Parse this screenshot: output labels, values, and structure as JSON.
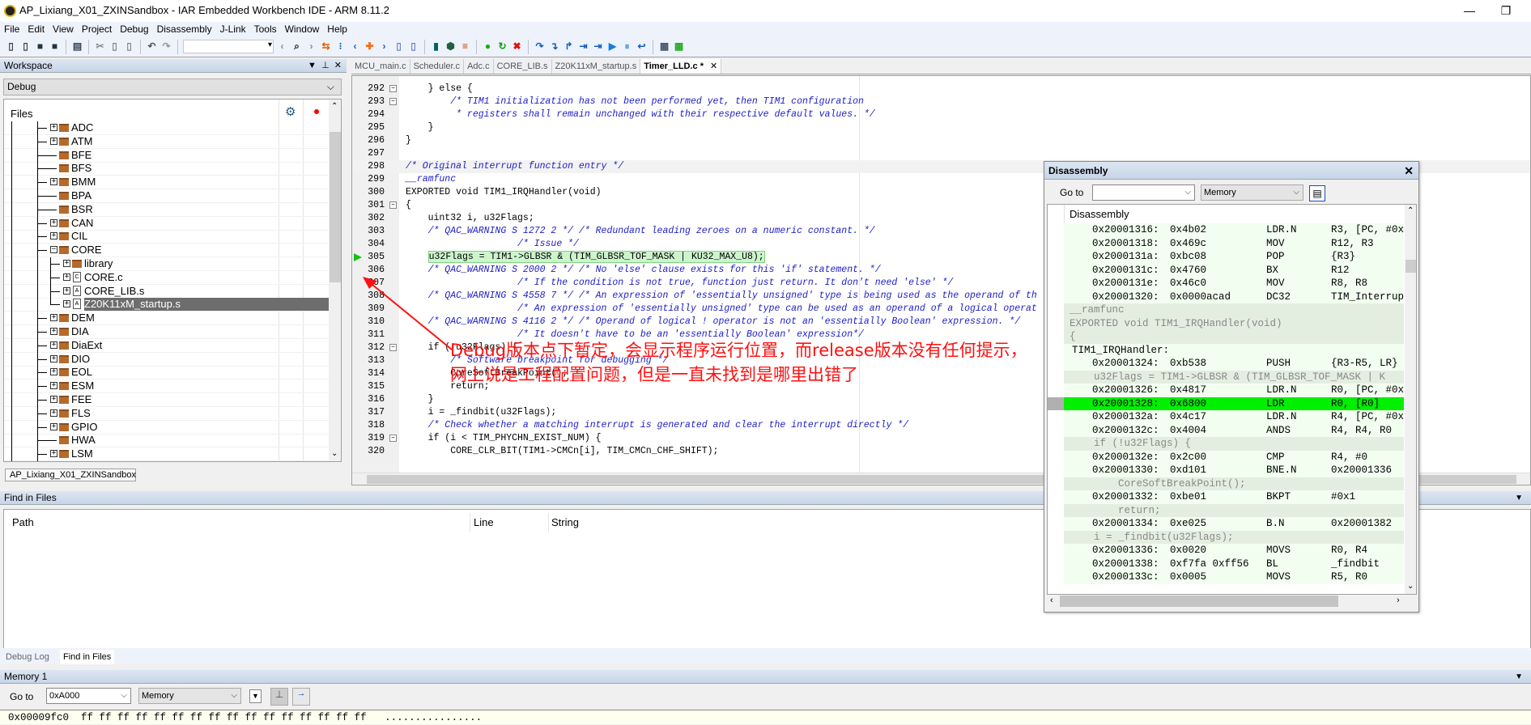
{
  "window": {
    "title": "AP_Lixiang_X01_ZXINSandbox - IAR Embedded Workbench IDE - ARM 8.11.2",
    "minimize": "—",
    "restore": "❐"
  },
  "menu": [
    "File",
    "Edit",
    "View",
    "Project",
    "Debug",
    "Disassembly",
    "J-Link",
    "Tools",
    "Window",
    "Help"
  ],
  "toolbar": [
    {
      "name": "new-file",
      "glyph": "▯",
      "color": "#444"
    },
    {
      "name": "open-file",
      "glyph": "▯",
      "color": "#444"
    },
    {
      "name": "save",
      "glyph": "■",
      "color": "#234"
    },
    {
      "name": "save-all",
      "glyph": "■",
      "color": "#234"
    },
    {
      "sep": true
    },
    {
      "name": "print",
      "glyph": "▤",
      "color": "#345"
    },
    {
      "sep": true
    },
    {
      "name": "cut",
      "glyph": "✂",
      "color": "#888"
    },
    {
      "name": "copy",
      "glyph": "▯",
      "color": "#888"
    },
    {
      "name": "paste",
      "glyph": "▯",
      "color": "#888"
    },
    {
      "sep": true
    },
    {
      "name": "undo",
      "glyph": "↶",
      "color": "#555"
    },
    {
      "name": "redo",
      "glyph": "↷",
      "color": "#999"
    },
    {
      "sep": true
    },
    {
      "combo": true
    },
    {
      "name": "navigate-back",
      "glyph": "‹",
      "color": "#888"
    },
    {
      "name": "find",
      "glyph": "⌕",
      "color": "#222"
    },
    {
      "name": "navigate-forward",
      "glyph": "›",
      "color": "#888"
    },
    {
      "name": "go-to-definition",
      "glyph": "⇆",
      "color": "#e06000"
    },
    {
      "name": "bookmarks",
      "glyph": "⁝",
      "color": "#1060c0"
    },
    {
      "name": "previous-bookmark",
      "glyph": "‹",
      "color": "#1060c0"
    },
    {
      "name": "toggle-bookmark",
      "glyph": "✚",
      "color": "#f07020"
    },
    {
      "name": "next-bookmark",
      "glyph": "›",
      "color": "#1060c0"
    },
    {
      "name": "previous-doc",
      "glyph": "▯",
      "color": "#6a8ac0"
    },
    {
      "name": "next-doc",
      "glyph": "▯",
      "color": "#6a8ac0"
    },
    {
      "sep": true
    },
    {
      "name": "download",
      "glyph": "▮",
      "color": "#006060"
    },
    {
      "name": "download-debug",
      "glyph": "⬢",
      "color": "#206040"
    },
    {
      "name": "breakpoint-list",
      "glyph": "≡",
      "color": "#c04000"
    },
    {
      "sep": true
    },
    {
      "name": "go",
      "glyph": "●",
      "color": "#10b010"
    },
    {
      "name": "reset",
      "glyph": "↻",
      "color": "#10a010"
    },
    {
      "name": "stop-debug",
      "glyph": "✖",
      "color": "#e01010"
    },
    {
      "sep": true
    },
    {
      "name": "step-over",
      "glyph": "↷",
      "color": "#1060c0"
    },
    {
      "name": "step-into",
      "glyph": "↴",
      "color": "#1060c0"
    },
    {
      "name": "step-out",
      "glyph": "↱",
      "color": "#1060c0"
    },
    {
      "name": "next-statement",
      "glyph": "⇥",
      "color": "#1060c0"
    },
    {
      "name": "run-to-cursor",
      "glyph": "⇥",
      "color": "#1060c0"
    },
    {
      "name": "run",
      "glyph": "▶",
      "color": "#1080e0"
    },
    {
      "name": "break",
      "glyph": "⏸",
      "color": "#60a0e0"
    },
    {
      "name": "return",
      "glyph": "↩",
      "color": "#1060c0"
    },
    {
      "sep": true
    },
    {
      "name": "window-layout",
      "glyph": "▦",
      "color": "#456"
    },
    {
      "name": "add-window",
      "glyph": "▦",
      "color": "#2a2"
    }
  ],
  "workspace": {
    "title": "Workspace",
    "controls": [
      "▼",
      "⊥",
      "✕"
    ],
    "configuration": "Debug",
    "files_header": "Files",
    "gear_icon_color": "#1f5a8a",
    "breakpoint_dot_color": "#ff0000",
    "items": [
      {
        "label": "ADC",
        "type": "folder",
        "level": 1,
        "expander": "+"
      },
      {
        "label": "ATM",
        "type": "folder",
        "level": 1,
        "expander": "+"
      },
      {
        "label": "BFE",
        "type": "folder",
        "level": 1,
        "expander": ""
      },
      {
        "label": "BFS",
        "type": "folder",
        "level": 1,
        "expander": ""
      },
      {
        "label": "BMM",
        "type": "folder",
        "level": 1,
        "expander": "+"
      },
      {
        "label": "BPA",
        "type": "folder",
        "level": 1,
        "expander": ""
      },
      {
        "label": "BSR",
        "type": "folder",
        "level": 1,
        "expander": ""
      },
      {
        "label": "CAN",
        "type": "folder",
        "level": 1,
        "expander": "+"
      },
      {
        "label": "CIL",
        "type": "folder",
        "level": 1,
        "expander": "+"
      },
      {
        "label": "CORE",
        "type": "folder",
        "level": 1,
        "expander": "−"
      },
      {
        "label": "library",
        "type": "folder",
        "level": 2,
        "expander": "+"
      },
      {
        "label": "CORE.c",
        "type": "c-file",
        "level": 2,
        "expander": "+"
      },
      {
        "label": "CORE_LIB.s",
        "type": "asm-file",
        "level": 2,
        "expander": "+"
      },
      {
        "label": "Z20K11xM_startup.s",
        "type": "asm-file",
        "level": 2,
        "expander": "+",
        "selected": true
      },
      {
        "label": "DEM",
        "type": "folder",
        "level": 1,
        "expander": "+"
      },
      {
        "label": "DIA",
        "type": "folder",
        "level": 1,
        "expander": "+"
      },
      {
        "label": "DiaExt",
        "type": "folder",
        "level": 1,
        "expander": "+"
      },
      {
        "label": "DIO",
        "type": "folder",
        "level": 1,
        "expander": "+"
      },
      {
        "label": "EOL",
        "type": "folder",
        "level": 1,
        "expander": "+"
      },
      {
        "label": "ESM",
        "type": "folder",
        "level": 1,
        "expander": "+"
      },
      {
        "label": "FEE",
        "type": "folder",
        "level": 1,
        "expander": "+"
      },
      {
        "label": "FLS",
        "type": "folder",
        "level": 1,
        "expander": "+"
      },
      {
        "label": "GPIO",
        "type": "folder",
        "level": 1,
        "expander": "+"
      },
      {
        "label": "HWA",
        "type": "folder",
        "level": 1,
        "expander": ""
      },
      {
        "label": "LSM",
        "type": "folder",
        "level": 1,
        "expander": "+"
      }
    ],
    "tab": "AP_Lixiang_X01_ZXINSandbox"
  },
  "editor": {
    "tabs": [
      {
        "label": "MCU_main.c"
      },
      {
        "label": "Scheduler.c"
      },
      {
        "label": "Adc.c"
      },
      {
        "label": "CORE_LIB.s"
      },
      {
        "label": "Z20K11xM_startup.s"
      },
      {
        "label": "Timer_LLD.c *",
        "active": true
      }
    ],
    "tab_close": "✕",
    "current_pc_line": 305,
    "lines": [
      {
        "n": "292",
        "t": "    } else {",
        "fold": "−"
      },
      {
        "n": "293",
        "t": "        /* TIM1 initialization has not been performed yet, then TIM1 configuration",
        "fold": "−",
        "c": 1
      },
      {
        "n": "294",
        "t": "         * registers shall remain unchanged with their respective default values. */",
        "c": 1
      },
      {
        "n": "295",
        "t": "    }"
      },
      {
        "n": "296",
        "t": "}"
      },
      {
        "n": "297",
        "t": ""
      },
      {
        "n": "298",
        "t": "/* Original interrupt function entry */",
        "c": 1,
        "cur": 1
      },
      {
        "n": "299",
        "t": "__ramfunc",
        "c": 1
      },
      {
        "n": "300",
        "t": "EXPORTED void TIM1_IRQHandler(void)"
      },
      {
        "n": "301",
        "t": "{",
        "fold": "−"
      },
      {
        "n": "302",
        "t": "    uint32 i, u32Flags;"
      },
      {
        "n": "303",
        "t": "    /* QAC_WARNING S 1272 2 */ /* Redundant leading zeroes on a numeric constant. */",
        "c": 1
      },
      {
        "n": "304",
        "t": "                    /* Issue */",
        "c": 1
      },
      {
        "n": "305",
        "t": "u32Flags = TIM1->GLBSR & (TIM_GLBSR_TOF_MASK | KU32_MAX_U8);",
        "pc": 1
      },
      {
        "n": "306",
        "t": "    /* QAC_WARNING S 2000 2 */ /* No 'else' clause exists for this 'if' statement. */",
        "c": 1
      },
      {
        "n": "307",
        "t": "                    /* If the condition is not true, function just return. It don't need 'else' */",
        "c": 1
      },
      {
        "n": "308",
        "t": "    /* QAC_WARNING S 4558 7 */ /* An expression of 'essentially unsigned' type is being used as the operand of th",
        "c": 1
      },
      {
        "n": "309",
        "t": "                    /* An expression of 'essentially unsigned' type can be used as an operand of a logical operat",
        "c": 1
      },
      {
        "n": "310",
        "t": "    /* QAC_WARNING S 4116 2 */ /* Operand of logical ! operator is not an 'essentially Boolean' expression. */",
        "c": 1
      },
      {
        "n": "311",
        "t": "                    /* It doesn't have to be an 'essentially Boolean' expression*/",
        "c": 1
      },
      {
        "n": "312",
        "t": "    if (!u32Flags) {",
        "fold": "−"
      },
      {
        "n": "313",
        "t": "        /* Software breakpoint for debugging */",
        "c": 1
      },
      {
        "n": "314",
        "t": "        CoreSoftBreakPoint();"
      },
      {
        "n": "315",
        "t": "        return;"
      },
      {
        "n": "316",
        "t": "    }"
      },
      {
        "n": "317",
        "t": "    i = _findbit(u32Flags);"
      },
      {
        "n": "318",
        "t": "    /* Check whether a matching interrupt is generated and clear the interrupt directly */",
        "c": 1
      },
      {
        "n": "319",
        "t": "    if (i < TIM_PHYCHN_EXIST_NUM) {",
        "fold": "−"
      },
      {
        "n": "320",
        "t": "        CORE_CLR_BIT(TIM1->CMCn[i], TIM_CMCn_CHF_SHIFT);"
      }
    ]
  },
  "annotation": {
    "line1": "Debug版本点下暂定，会显示程序运行位置，而release版本没有任何提示，",
    "line2": "网上说是工程配置问题，但是一直未找到是哪里出错了",
    "color": "#ff1010"
  },
  "disassembly": {
    "title": "Disassembly",
    "close": "✕",
    "goto_label": "Go to",
    "goto_value": "",
    "zone": "Memory",
    "column_header": "Disassembly",
    "current_highlight_color": "#00f000",
    "rows": [
      {
        "k": "a",
        "addr": "0x20001316:",
        "code": "0x4b02",
        "op": "LDR.N",
        "args": "R3, [PC, #0x"
      },
      {
        "k": "a",
        "addr": "0x20001318:",
        "code": "0x469c",
        "op": "MOV",
        "args": "R12, R3"
      },
      {
        "k": "a",
        "addr": "0x2000131a:",
        "code": "0xbc08",
        "op": "POP",
        "args": "{R3}"
      },
      {
        "k": "a",
        "addr": "0x2000131c:",
        "code": "0x4760",
        "op": "BX",
        "args": "R12"
      },
      {
        "k": "a",
        "addr": "0x2000131e:",
        "code": "0x46c0",
        "op": "MOV",
        "args": "R8, R8"
      },
      {
        "k": "a",
        "addr": "0x20001320:",
        "code": "0x0000acad",
        "op": "DC32",
        "args": "TIM_Interrup"
      },
      {
        "k": "s",
        "text": "__ramfunc"
      },
      {
        "k": "s",
        "text": "EXPORTED void TIM1_IRQHandler(void)"
      },
      {
        "k": "s",
        "text": "{"
      },
      {
        "k": "l",
        "text": "TIM1_IRQHandler:"
      },
      {
        "k": "a",
        "addr": "0x20001324:",
        "code": "0xb538",
        "op": "PUSH",
        "args": "{R3-R5, LR}"
      },
      {
        "k": "s",
        "text": "    u32Flags = TIM1->GLBSR & (TIM_GLBSR_TOF_MASK | K"
      },
      {
        "k": "a",
        "addr": "0x20001326:",
        "code": "0x4817",
        "op": "LDR.N",
        "args": "R0, [PC, #0x"
      },
      {
        "k": "a",
        "addr": "0x20001328:",
        "code": "0x6800",
        "op": "LDR",
        "args": "R0, [R0]",
        "current": true
      },
      {
        "k": "a",
        "addr": "0x2000132a:",
        "code": "0x4c17",
        "op": "LDR.N",
        "args": "R4, [PC, #0x"
      },
      {
        "k": "a",
        "addr": "0x2000132c:",
        "code": "0x4004",
        "op": "ANDS",
        "args": "R4, R4, R0"
      },
      {
        "k": "s",
        "text": "    if (!u32Flags) {"
      },
      {
        "k": "a",
        "addr": "0x2000132e:",
        "code": "0x2c00",
        "op": "CMP",
        "args": "R4, #0"
      },
      {
        "k": "a",
        "addr": "0x20001330:",
        "code": "0xd101",
        "op": "BNE.N",
        "args": "0x20001336"
      },
      {
        "k": "s",
        "text": "        CoreSoftBreakPoint();"
      },
      {
        "k": "a",
        "addr": "0x20001332:",
        "code": "0xbe01",
        "op": "BKPT",
        "args": "#0x1"
      },
      {
        "k": "s",
        "text": "        return;"
      },
      {
        "k": "a",
        "addr": "0x20001334:",
        "code": "0xe025",
        "op": "B.N",
        "args": "0x20001382"
      },
      {
        "k": "s",
        "text": "    i = _findbit(u32Flags);"
      },
      {
        "k": "a",
        "addr": "0x20001336:",
        "code": "0x0020",
        "op": "MOVS",
        "args": "R0, R4"
      },
      {
        "k": "a",
        "addr": "0x20001338:",
        "code": "0xf7fa 0xff56",
        "op": "BL",
        "args": "_findbit"
      },
      {
        "k": "a",
        "addr": "0x2000133c:",
        "code": "0x0005",
        "op": "MOVS",
        "args": "R5, R0"
      }
    ]
  },
  "find_in_files": {
    "title": "Find in Files",
    "columns": [
      "Path",
      "Line",
      "String"
    ]
  },
  "bottom_tabs": [
    "Debug Log",
    "Find in Files"
  ],
  "memory": {
    "title": "Memory 1",
    "goto_label": "Go to",
    "goto_value": "0xA000",
    "zone": "Memory",
    "row": {
      "addr": "0x00009fc0",
      "bytes": "ff ff ff ff ff ff ff ff ff ff ff ff ff ff ff ff",
      "ascii": "................"
    }
  }
}
